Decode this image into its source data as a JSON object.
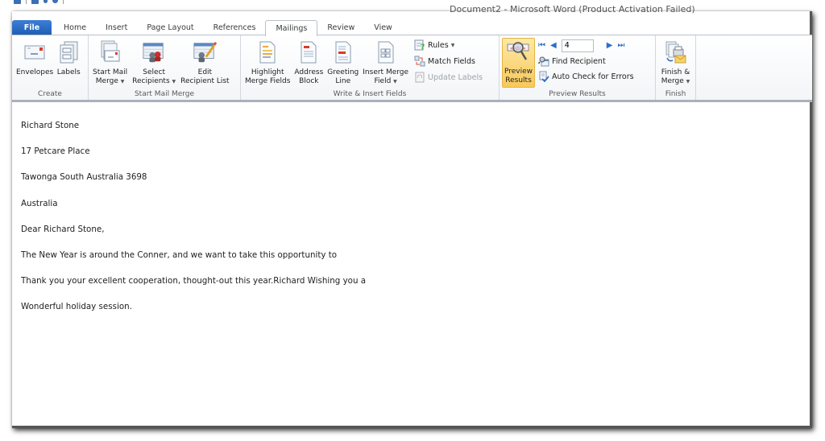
{
  "window": {
    "title": "Document2 - Microsoft Word (Product Activation Failed)"
  },
  "quick_access": [
    "save-icon",
    "undo-icon",
    "redo-icon",
    "customize-icon"
  ],
  "tabs": [
    {
      "label": "File",
      "active": false
    },
    {
      "label": "Home",
      "active": false
    },
    {
      "label": "Insert",
      "active": false
    },
    {
      "label": "Page Layout",
      "active": false
    },
    {
      "label": "References",
      "active": false
    },
    {
      "label": "Mailings",
      "active": true
    },
    {
      "label": "Review",
      "active": false
    },
    {
      "label": "View",
      "active": false
    }
  ],
  "ribbon": {
    "create": {
      "label": "Create",
      "envelopes": "Envelopes",
      "labels": "Labels"
    },
    "start_mail_merge": {
      "label": "Start Mail Merge",
      "start_mail_merge_1": "Start Mail",
      "start_mail_merge_2": "Merge",
      "select_recipients_1": "Select",
      "select_recipients_2": "Recipients",
      "edit_recipient_list_1": "Edit",
      "edit_recipient_list_2": "Recipient List"
    },
    "write_insert": {
      "label": "Write & Insert Fields",
      "highlight_1": "Highlight",
      "highlight_2": "Merge Fields",
      "address_1": "Address",
      "address_2": "Block",
      "greeting_1": "Greeting",
      "greeting_2": "Line",
      "insert_merge_1": "Insert Merge",
      "insert_merge_2": "Field",
      "rules": "Rules",
      "match_fields": "Match Fields",
      "update_labels": "Update Labels"
    },
    "preview_results": {
      "label": "Preview Results",
      "preview_1": "Preview",
      "preview_2": "Results",
      "record_value": "4",
      "find_recipient": "Find Recipient",
      "auto_check": "Auto Check for Errors"
    },
    "finish": {
      "label": "Finish",
      "finish_1": "Finish &",
      "finish_2": "Merge"
    }
  },
  "document": {
    "paragraphs": [
      "Richard Stone",
      "17 Petcare Place",
      "Tawonga South Australia 3698",
      "Australia",
      "Dear Richard Stone,",
      "The New Year is around the Conner, and we want to take this opportunity to",
      "Thank you your excellent cooperation, thought-out this year.Richard Wishing you a",
      "Wonderful holiday session."
    ]
  },
  "colors": {
    "file_tab": "#2a6bc3",
    "pressed_button": "#f8c95a",
    "nav_arrow": "#2d6fc9"
  }
}
